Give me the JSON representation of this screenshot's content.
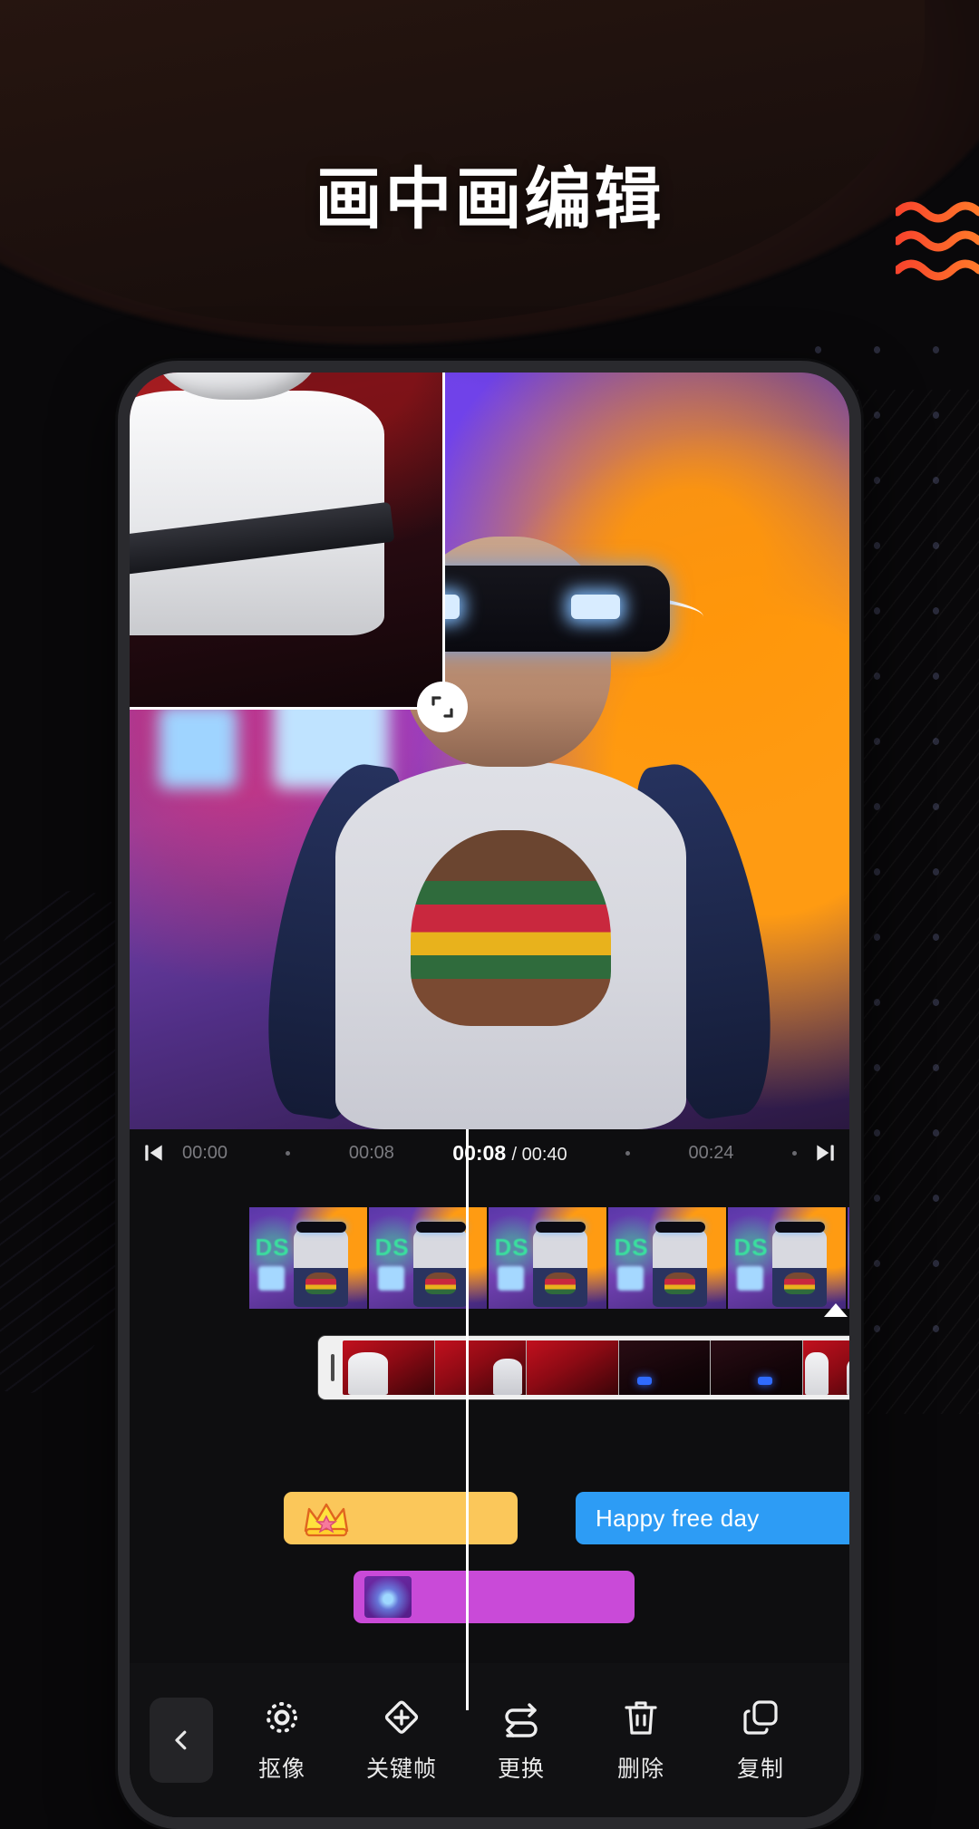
{
  "page": {
    "title": "画中画编辑",
    "accent_red": "#ec5050",
    "accent_orange": "#fa5a28",
    "text_clip_color": "#2d9cf5",
    "sticker_clip_color": "#fbc75a",
    "fx_clip_color": "#c94ad8"
  },
  "decor": {
    "waves_name": "wavy-lines-decoration",
    "dotgrid_name": "dot-grid-decoration"
  },
  "preview": {
    "pip_overlay_name": "picture-in-picture-overlay",
    "handles": [
      {
        "name": "close-icon",
        "label": "×",
        "position": "top-left"
      },
      {
        "name": "mirror-icon",
        "label": "",
        "position": "bottom-left"
      },
      {
        "name": "scale-icon",
        "label": "",
        "position": "bottom-right"
      }
    ]
  },
  "timebar": {
    "prev_frame_icon": "skip-previous-icon",
    "next_frame_icon": "skip-next-icon",
    "ticks_left": [
      "00:00",
      "00:08"
    ],
    "ticks_right": [
      "00:24"
    ],
    "current_time": "00:08",
    "total_time": "/ 00:40"
  },
  "timeline": {
    "main_track_name": "main-video-track",
    "pip_track_name": "pip-video-track",
    "clips": {
      "sticker": {
        "name": "sticker-clip",
        "icon": "crown-sticker-icon",
        "label": ""
      },
      "text": {
        "name": "text-clip",
        "label": "Happy free day"
      },
      "effect": {
        "name": "effect-clip",
        "label": ""
      }
    },
    "playhead_name": "playhead"
  },
  "toolbar": {
    "back_icon": "chevron-left-icon",
    "tools": [
      {
        "label": "抠像",
        "icon": "chroma-key-icon"
      },
      {
        "label": "关键帧",
        "icon": "keyframe-icon"
      },
      {
        "label": "更换",
        "icon": "replace-icon"
      },
      {
        "label": "删除",
        "icon": "trash-icon"
      },
      {
        "label": "复制",
        "icon": "copy-icon"
      }
    ]
  }
}
